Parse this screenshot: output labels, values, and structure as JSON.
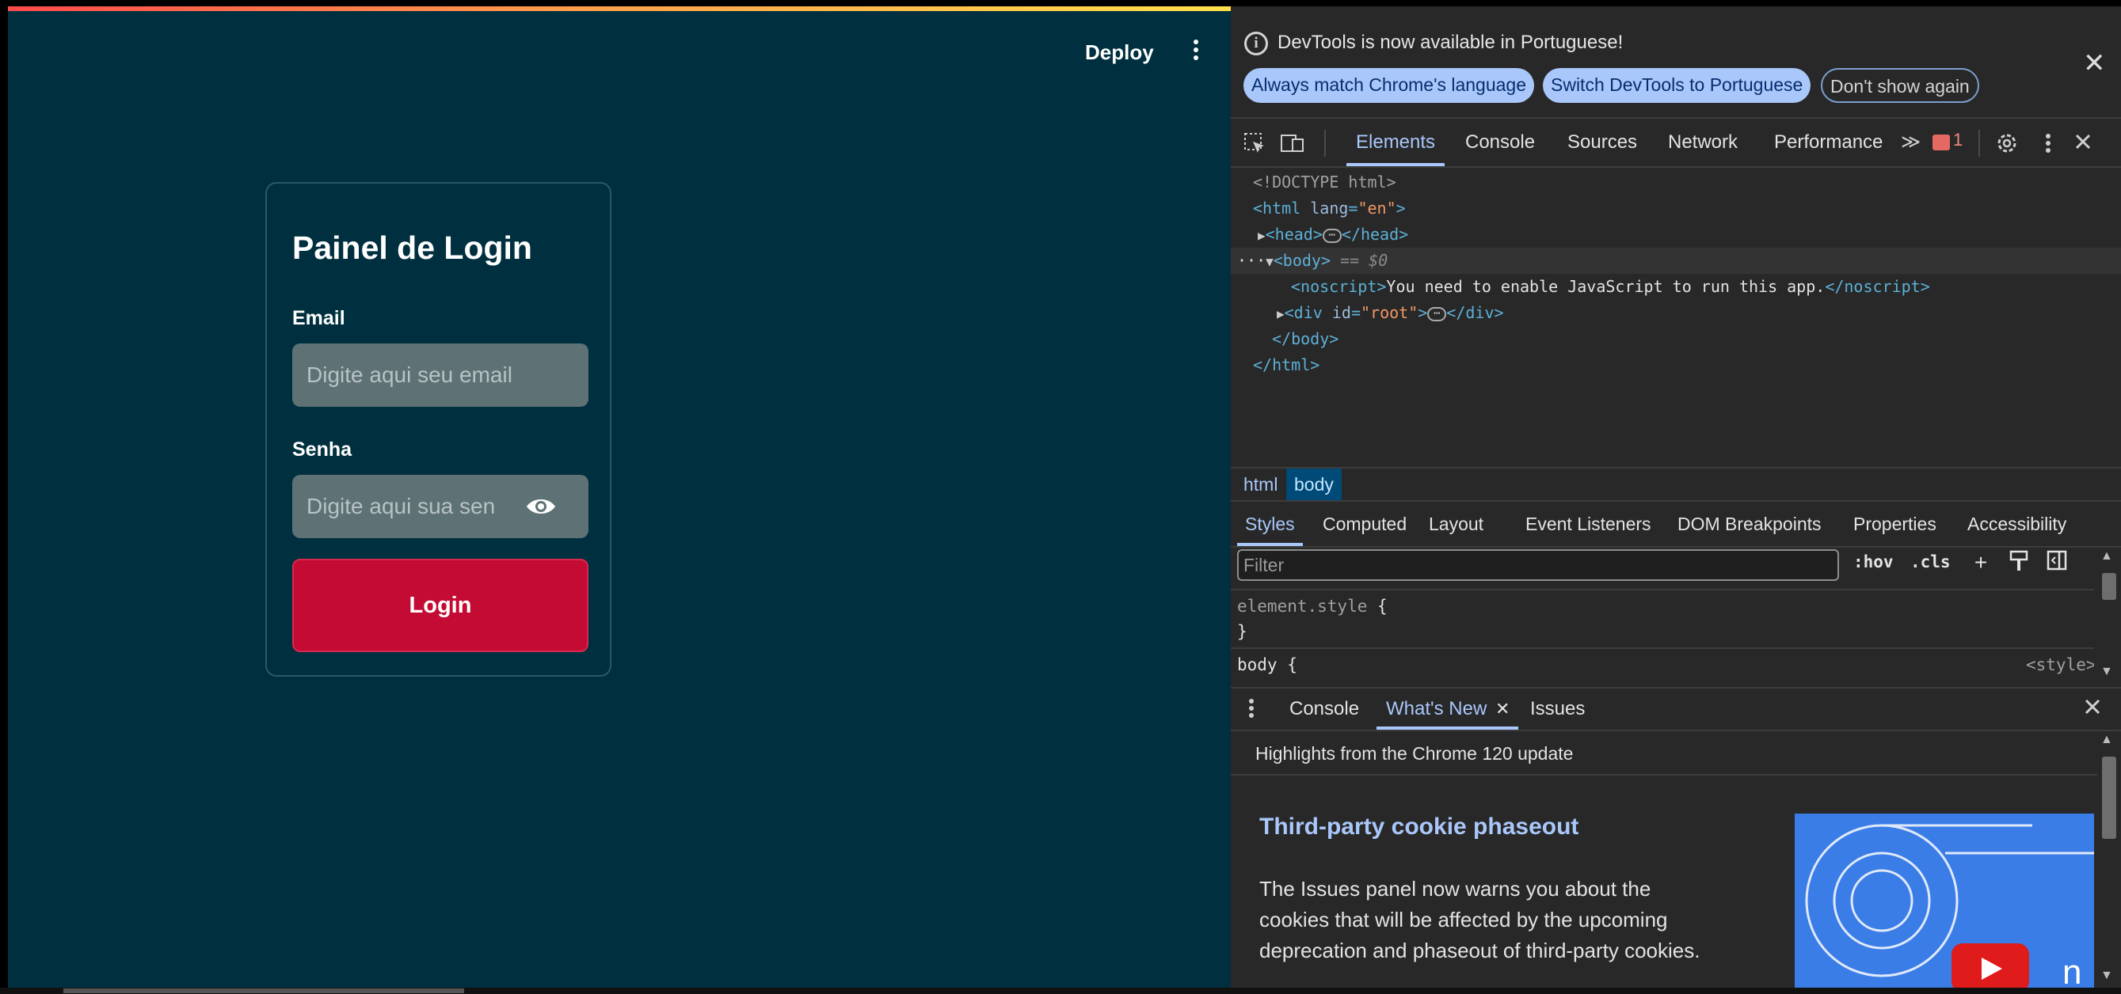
{
  "app": {
    "deploy_label": "Deploy",
    "login": {
      "title": "Painel de Login",
      "email_label": "Email",
      "email_placeholder": "Digite aqui seu email",
      "password_label": "Senha",
      "password_placeholder": "Digite aqui sua sen",
      "button_label": "Login"
    },
    "colors": {
      "background": "#00303f",
      "input": "#5e7174",
      "button": "#c30b33"
    }
  },
  "devtools": {
    "banner": {
      "text": "DevTools is now available in Portuguese!",
      "buttons": [
        "Always match Chrome's language",
        "Switch DevTools to Portuguese",
        "Don't show again"
      ],
      "close": "✕"
    },
    "tabs": [
      "Elements",
      "Console",
      "Sources",
      "Network",
      "Performance"
    ],
    "more_tabs": "≫",
    "error_count": "1",
    "icons": {
      "inspect": "inspect-element-icon",
      "device": "device-toolbar-icon",
      "settings": "gear-icon",
      "menu": "kebab-icon",
      "close": "close-icon"
    },
    "dom": {
      "doctype": "<!DOCTYPE html>",
      "html_open_tag": "<html ",
      "html_attr": "lang",
      "html_eq": "=",
      "html_val": "\"en\"",
      "gt": ">",
      "head_open": "<head>",
      "head_close": "</head>",
      "body_open": "<body>",
      "body_marker": " == $0",
      "noscript_open": "<noscript>",
      "noscript_text": "You need to enable JavaScript to run this app.",
      "noscript_close": "</noscript>",
      "div_open": "<div ",
      "div_attr": "id",
      "div_val": "\"root\"",
      "div_close": "</div>",
      "body_close": "</body>",
      "html_close": "</html>",
      "dots": "···"
    },
    "breadcrumbs": [
      "html",
      "body"
    ],
    "style_tabs": [
      "Styles",
      "Computed",
      "Layout",
      "Event Listeners",
      "DOM Breakpoints",
      "Properties",
      "Accessibility"
    ],
    "filter_placeholder": "Filter",
    "hov": ":hov",
    "cls": ".cls",
    "styles": {
      "element_style": "element.style",
      "open_brace": " {",
      "close_brace": "}",
      "body_selector": "body",
      "source": "<style>"
    },
    "drawer": {
      "tabs": [
        "Console",
        "What's New",
        "Issues"
      ],
      "highlights": "Highlights from the Chrome 120 update",
      "article_title": "Third-party cookie phaseout",
      "article_body": "The Issues panel now warns you about the cookies that will be affected by the upcoming deprecation and phaseout of third-party cookies."
    }
  }
}
